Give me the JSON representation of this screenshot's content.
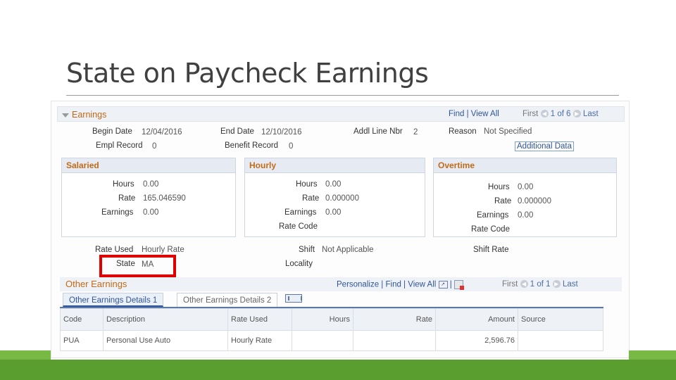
{
  "slide": {
    "title": "State on Paycheck Earnings"
  },
  "earnings": {
    "header": "Earnings",
    "find": "Find",
    "view_all": "View All",
    "first": "First",
    "counter": "1 of 6",
    "last": "Last",
    "begin_date_label": "Begin Date",
    "begin_date": "12/04/2016",
    "end_date_label": "End Date",
    "end_date": "12/10/2016",
    "addl_line_label": "Addl Line Nbr",
    "addl_line": "2",
    "reason_label": "Reason",
    "reason": "Not Specified",
    "empl_record_label": "Empl Record",
    "empl_record": "0",
    "benefit_record_label": "Benefit Record",
    "benefit_record": "0",
    "additional_data": "Additional Data"
  },
  "salaried": {
    "header": "Salaried",
    "hours_label": "Hours",
    "hours": "0.00",
    "rate_label": "Rate",
    "rate": "165.046590",
    "earnings_label": "Earnings",
    "earnings": "0.00"
  },
  "hourly": {
    "header": "Hourly",
    "hours_label": "Hours",
    "hours": "0.00",
    "rate_label": "Rate",
    "rate": "0.000000",
    "earnings_label": "Earnings",
    "earnings": "0.00",
    "rate_code_label": "Rate Code"
  },
  "overtime": {
    "header": "Overtime",
    "hours_label": "Hours",
    "hours": "0.00",
    "rate_label": "Rate",
    "rate": "0.000000",
    "earnings_label": "Earnings",
    "earnings": "0.00",
    "rate_code_label": "Rate Code"
  },
  "details": {
    "rate_used_label": "Rate Used",
    "rate_used": "Hourly Rate",
    "shift_label": "Shift",
    "shift": "Not Applicable",
    "shift_rate_label": "Shift Rate",
    "state_label": "State",
    "state": "MA",
    "locality_label": "Locality"
  },
  "other_earnings": {
    "header": "Other Earnings",
    "personalize": "Personalize",
    "find": "Find",
    "view_all": "View All",
    "first": "First",
    "counter": "1 of 1",
    "last": "Last",
    "tabs": [
      "Other Earnings Details 1",
      "Other Earnings Details 2"
    ],
    "columns": [
      "Code",
      "Description",
      "Rate Used",
      "Hours",
      "Rate",
      "Amount",
      "Source"
    ],
    "rows": [
      {
        "code": "PUA",
        "description": "Personal Use Auto",
        "rate_used": "Hourly Rate",
        "hours": "",
        "rate": "",
        "amount": "2,596.76",
        "source": ""
      }
    ]
  },
  "icons": [
    "collapse-triangle-icon",
    "previous-icon",
    "next-icon",
    "zoom-icon",
    "download-icon",
    "show-all-columns-icon"
  ],
  "colors": {
    "accent_green": "#5a9e2f",
    "highlight_red": "#e00000",
    "link_blue": "#30559a",
    "header_orange": "#c36a14"
  }
}
